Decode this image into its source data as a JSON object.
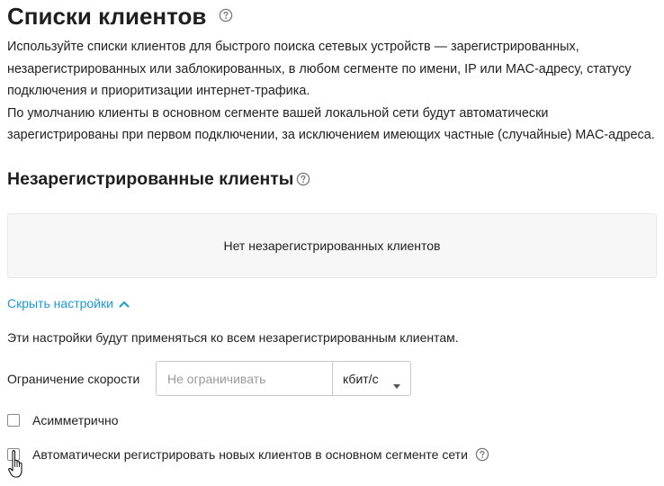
{
  "page": {
    "title": "Списки клиентов",
    "intro_paragraphs": [
      "Используйте списки клиентов для быстрого поиска сетевых устройств — зарегистрированных, незарегистрированных или заблокированных, в любом сегменте по имени, IP или MAC-адресу, статусу подключения и приоритизации интернет-трафика.",
      "По умолчанию клиенты в основном сегменте вашей локальной сети будут автоматически зарегистрированы при первом подключении, за исключением имеющих частные (случайные) MAC-адреса."
    ]
  },
  "unregistered": {
    "title": "Незарегистрированные клиенты",
    "empty_text": "Нет незарегистрированных клиентов"
  },
  "settings": {
    "toggle_label": "Скрыть настройки",
    "note": "Эти настройки будут применяться ко всем незарегистрированным клиентам.",
    "speed_limit_label": "Ограничение скорости",
    "speed_limit_value": "",
    "speed_limit_placeholder": "Не ограничивать",
    "unit_selected": "кбит/с",
    "asymmetric_label": "Асимметрично",
    "asymmetric_checked": false,
    "auto_register_label": "Автоматически регистрировать новых клиентов в основном сегменте сети",
    "auto_register_checked": false
  },
  "colors": {
    "link": "#1a9bd7",
    "text": "#222222",
    "box_bg": "#f7f7f7"
  },
  "icons": {
    "help": "help-icon",
    "chevron": "chevron-up-icon",
    "caret": "caret-down-icon",
    "cursor": "hand-pointer-icon"
  }
}
